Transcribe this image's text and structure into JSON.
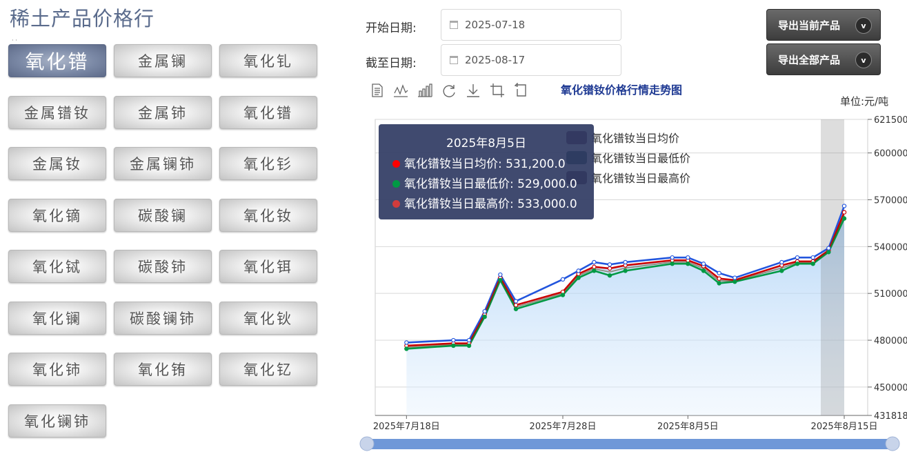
{
  "page": {
    "title": "稀土产品价格行",
    "dots": "· ·",
    "start_label": "开始日期:",
    "end_label": "截至日期:",
    "start_date": "2025-07-18",
    "end_date": "2025-08-17",
    "export_current": "导出当前产品",
    "export_all": "导出全部产品",
    "unit": "单位:元/吨"
  },
  "products": [
    "氧化镨",
    "金属镧",
    "氧化钆",
    "金属镨钕",
    "金属铈",
    "氧化镨",
    "金属钕",
    "金属镧铈",
    "氧化钐",
    "氧化镝",
    "碳酸镧",
    "氧化钕",
    "氧化铽",
    "碳酸铈",
    "氧化铒",
    "氧化镧",
    "碳酸镧铈",
    "氧化钬",
    "氧化铈",
    "氧化铕",
    "氧化钇",
    "氧化镧铈"
  ],
  "active_product_index": 0,
  "tooltip": {
    "title": "2025年8月5日",
    "rows": [
      {
        "text": "氧化镨钕当日均价: 531,200.0",
        "color": "#ff0000"
      },
      {
        "text": "氧化镨钕当日最低价: 529,000.0",
        "color": "#009944"
      },
      {
        "text": "氧化镨钕当日最高价: 533,000.0",
        "color": "#d23c3c"
      }
    ]
  },
  "legend_colors": [
    "#4a1538",
    "#0d3a3a",
    "#3a1030"
  ],
  "chart_data": {
    "type": "line",
    "title": "氧化镨钕价格行情走势图",
    "ylabel": "单位:元/吨",
    "ylim": [
      431818,
      621500
    ],
    "y_ticks": [
      "621500",
      "600000",
      "570000",
      "540000",
      "510000",
      "480000",
      "450000",
      "431818"
    ],
    "x_tick_labels": [
      "2025年7月18日",
      "2025年7月28日",
      "2025年8月5日",
      "2025年8月15日"
    ],
    "x": [
      "2025-07-18",
      "2025-07-21",
      "2025-07-22",
      "2025-07-23",
      "2025-07-24",
      "2025-07-25",
      "2025-07-28",
      "2025-07-29",
      "2025-07-30",
      "2025-07-31",
      "2025-08-01",
      "2025-08-04",
      "2025-08-05",
      "2025-08-06",
      "2025-08-07",
      "2025-08-08",
      "2025-08-11",
      "2025-08-12",
      "2025-08-13",
      "2025-08-14",
      "2025-08-15"
    ],
    "series": [
      {
        "name": "氧化镨钕当日均价",
        "color": "#cc0000",
        "values": [
          476500,
          478000,
          478000,
          496500,
          520000,
          502500,
          511000,
          522500,
          527000,
          526000,
          528000,
          531200,
          531200,
          527500,
          519500,
          518500,
          528000,
          530500,
          530500,
          537500,
          562000
        ]
      },
      {
        "name": "氧化镨钕当日最低价",
        "color": "#009944",
        "values": [
          474500,
          476500,
          476500,
          495000,
          518500,
          500000,
          509000,
          520000,
          524500,
          521500,
          524500,
          529000,
          529000,
          524500,
          516500,
          517500,
          524500,
          529000,
          529000,
          536500,
          558000
        ]
      },
      {
        "name": "氧化镨钕当日最高价",
        "color": "#2255dd",
        "values": [
          478500,
          480000,
          480000,
          498500,
          522000,
          505000,
          519000,
          524500,
          530000,
          528500,
          530000,
          533000,
          533000,
          529000,
          523000,
          520000,
          530000,
          533000,
          533000,
          539000,
          566000
        ]
      }
    ],
    "grid": true,
    "legend_position": "top-right",
    "data_zoom_range": [
      0,
      1
    ]
  }
}
